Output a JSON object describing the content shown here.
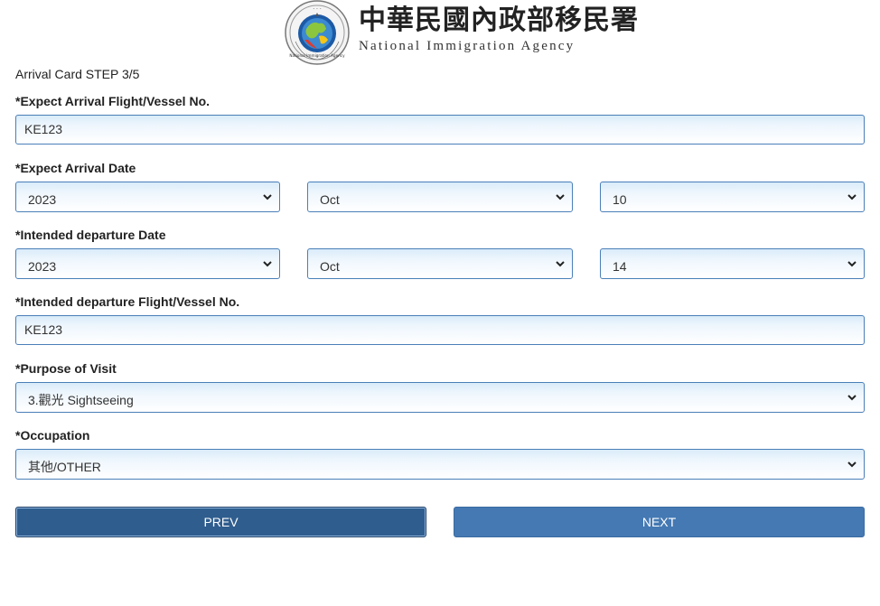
{
  "header": {
    "agency_cn": "中華民國內政部移民署",
    "agency_en": "National Immigration Agency",
    "seal_top_text": "內政部移民署",
    "seal_ring_text": "National Immigration Agency"
  },
  "step_label": "Arrival Card STEP 3/5",
  "arrival_flight": {
    "label": "*Expect Arrival Flight/Vessel No.",
    "value": "KE123"
  },
  "arrival_date": {
    "label": "*Expect Arrival Date",
    "year": "2023",
    "month": "Oct",
    "day": "10"
  },
  "departure_date": {
    "label": "*Intended departure Date",
    "year": "2023",
    "month": "Oct",
    "day": "14"
  },
  "departure_flight": {
    "label": "*Intended departure Flight/Vessel No.",
    "value": "KE123"
  },
  "purpose": {
    "label": "*Purpose of Visit",
    "value": "3.觀光 Sightseeing"
  },
  "occupation": {
    "label": "*Occupation",
    "value": "其他/OTHER"
  },
  "buttons": {
    "prev": "PREV",
    "next": "NEXT"
  },
  "colors": {
    "field_border": "#4a7fb8",
    "prev_button": "#2f5d8e",
    "next_button": "#4479b3"
  }
}
